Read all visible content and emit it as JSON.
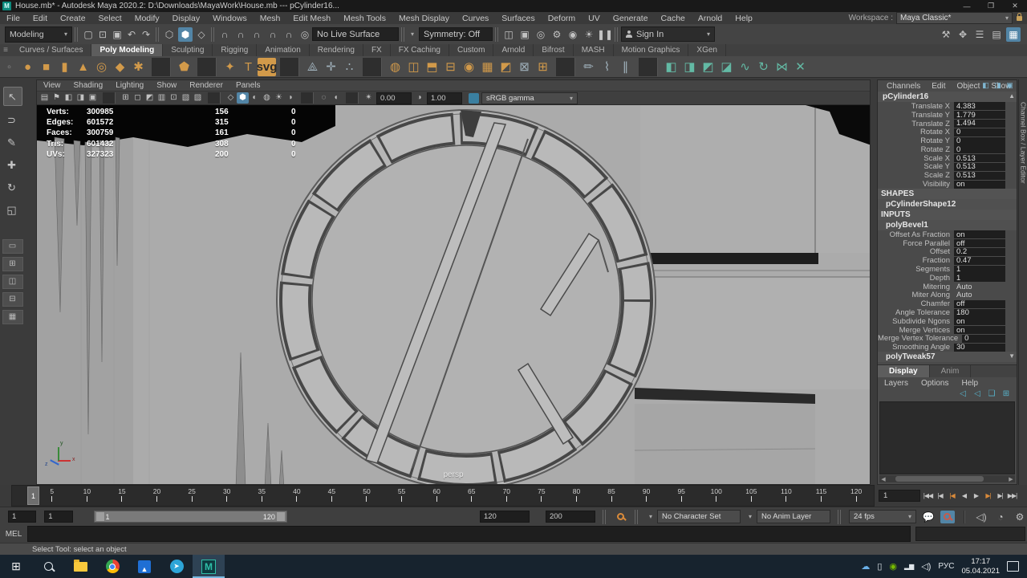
{
  "app": {
    "title": "House.mb* - Autodesk Maya 2020.2: D:\\Downloads\\MayaWork\\House.mb   ---   pCylinder16...",
    "icon": "M"
  },
  "window_controls": [
    {
      "name": "minimize-button",
      "glyph": "—"
    },
    {
      "name": "maximize-button",
      "glyph": "❐"
    },
    {
      "name": "close-button",
      "glyph": "✕"
    }
  ],
  "menu_bar": {
    "items": [
      "File",
      "Edit",
      "Create",
      "Select",
      "Modify",
      "Display",
      "Windows",
      "Mesh",
      "Edit Mesh",
      "Mesh Tools",
      "Mesh Display",
      "Curves",
      "Surfaces",
      "Deform",
      "UV",
      "Generate",
      "Cache",
      "Arnold",
      "Help"
    ]
  },
  "workspace": {
    "label": "Workspace :",
    "value": "Maya Classic*"
  },
  "status_line": {
    "mode": "Modeling",
    "file_icons": [
      {
        "name": "new-scene-icon",
        "glyph": "▢"
      },
      {
        "name": "open-scene-icon",
        "glyph": "⊡"
      },
      {
        "name": "save-scene-icon",
        "glyph": "▣"
      },
      {
        "name": "undo-icon",
        "glyph": "↶"
      },
      {
        "name": "redo-icon",
        "glyph": "↷"
      }
    ],
    "selection_icons": [
      {
        "name": "select-hierarchy-icon",
        "glyph": "⬡"
      },
      {
        "name": "select-object-icon",
        "glyph": "⬢",
        "cls": "active"
      },
      {
        "name": "select-component-icon",
        "glyph": "◇"
      }
    ],
    "snap_icons": [
      {
        "name": "snap-grid-icon",
        "glyph": "∩"
      },
      {
        "name": "snap-curve-icon",
        "glyph": "∩"
      },
      {
        "name": "snap-point-icon",
        "glyph": "∩"
      },
      {
        "name": "snap-projected-center-icon",
        "glyph": "∩"
      },
      {
        "name": "snap-view-plane-icon",
        "glyph": "∩"
      },
      {
        "name": "make-live-icon",
        "glyph": "◎"
      }
    ],
    "live_surface": "No Live Surface",
    "symmetry": "Symmetry: Off",
    "render_icons": [
      {
        "name": "render-view-icon",
        "glyph": "◫"
      },
      {
        "name": "render-current-frame-icon",
        "glyph": "▣"
      },
      {
        "name": "ipr-render-icon",
        "glyph": "◎"
      },
      {
        "name": "render-settings-icon",
        "glyph": "⚙"
      },
      {
        "name": "hypershade-icon",
        "glyph": "◉"
      },
      {
        "name": "light-editor-icon",
        "glyph": "☀"
      },
      {
        "name": "pause-viewport-icon",
        "glyph": "❚❚"
      }
    ],
    "sign_in": "Sign In",
    "right_icons": [
      {
        "name": "modeling-toolkit-toggle-icon",
        "glyph": "⚒"
      },
      {
        "name": "character-controls-toggle-icon",
        "glyph": "✥"
      },
      {
        "name": "attribute-editor-toggle-icon",
        "glyph": "☰"
      },
      {
        "name": "tool-settings-toggle-icon",
        "glyph": "▤"
      },
      {
        "name": "channel-box-toggle-icon",
        "glyph": "▦",
        "cls": "active"
      }
    ]
  },
  "shelf": {
    "tabs": [
      {
        "label": "Curves / Surfaces"
      },
      {
        "label": "Poly Modeling",
        "cls": "active"
      },
      {
        "label": "Sculpting"
      },
      {
        "label": "Rigging"
      },
      {
        "label": "Animation"
      },
      {
        "label": "Rendering"
      },
      {
        "label": "FX"
      },
      {
        "label": "FX Caching"
      },
      {
        "label": "Custom"
      },
      {
        "label": "Arnold"
      },
      {
        "label": "Bifrost"
      },
      {
        "label": "MASH"
      },
      {
        "label": "Motion Graphics"
      },
      {
        "label": "XGen"
      }
    ],
    "icons": [
      {
        "name": "poly-sphere-icon",
        "glyph": "●",
        "cls": "orange"
      },
      {
        "name": "poly-cube-icon",
        "glyph": "■",
        "cls": "orange"
      },
      {
        "name": "poly-cylinder-icon",
        "glyph": "▮",
        "cls": "orange"
      },
      {
        "name": "poly-cone-icon",
        "glyph": "▲",
        "cls": "orange"
      },
      {
        "name": "poly-torus-icon",
        "glyph": "◎",
        "cls": "orange"
      },
      {
        "name": "poly-plane-icon",
        "glyph": "◆",
        "cls": "orange"
      },
      {
        "name": "poly-disc-icon",
        "glyph": "✱",
        "cls": "orange"
      },
      {
        "cls": "vsep"
      },
      {
        "name": "platonic-solid-icon",
        "glyph": "⬟",
        "cls": "orange"
      },
      {
        "cls": "vsep"
      },
      {
        "name": "super-shape-icon",
        "glyph": "✦",
        "cls": "orange"
      },
      {
        "name": "poly-type-icon",
        "glyph": "T",
        "cls": "orange"
      },
      {
        "name": "svg-icon",
        "glyph": "svg",
        "cls": "badge"
      },
      {
        "cls": "vsep"
      },
      {
        "name": "construction-plane-icon",
        "glyph": "⟁",
        "cls": "gray"
      },
      {
        "name": "locator-icon",
        "glyph": "✛",
        "cls": "gray"
      },
      {
        "name": "origin-locator-icon",
        "glyph": "∴",
        "cls": "gray"
      },
      {
        "cls": "vsep"
      },
      {
        "name": "boolean-union-icon",
        "glyph": "◍",
        "cls": "orange"
      },
      {
        "name": "mirror-icon",
        "glyph": "◫",
        "cls": "orange"
      },
      {
        "name": "combine-icon",
        "glyph": "⬒",
        "cls": "orange"
      },
      {
        "name": "separate-icon",
        "glyph": "⊟",
        "cls": "orange"
      },
      {
        "name": "smooth-icon",
        "glyph": "◉",
        "cls": "orange"
      },
      {
        "name": "reduce-icon",
        "glyph": "▦",
        "cls": "orange"
      },
      {
        "name": "triangulate-icon",
        "glyph": "◩",
        "cls": "orange"
      },
      {
        "name": "fill-hole-icon",
        "glyph": "⊠",
        "cls": "gray"
      },
      {
        "name": "extrude-icon",
        "glyph": "⊞",
        "cls": "orange"
      },
      {
        "cls": "vsep"
      },
      {
        "name": "quad-draw-icon",
        "glyph": "✏",
        "cls": "gray"
      },
      {
        "name": "edit-edge-flow-icon",
        "glyph": "⌇",
        "cls": "gray"
      },
      {
        "name": "offset-edge-loop-icon",
        "glyph": "∥",
        "cls": "gray"
      },
      {
        "cls": "vsep"
      },
      {
        "name": "multi-cut-icon",
        "glyph": "◧",
        "cls": "green"
      },
      {
        "name": "connect-icon",
        "glyph": "◨",
        "cls": "green"
      },
      {
        "name": "crease-icon",
        "glyph": "◩",
        "cls": "green"
      },
      {
        "name": "bevel-icon",
        "glyph": "◪",
        "cls": "green"
      },
      {
        "name": "bridge-icon",
        "glyph": "∿",
        "cls": "green"
      },
      {
        "name": "spin-edge-icon",
        "glyph": "↻",
        "cls": "green"
      },
      {
        "name": "symmetrize-icon",
        "glyph": "⋈",
        "cls": "green"
      },
      {
        "name": "mirror-cut-icon",
        "glyph": "✕",
        "cls": "green"
      }
    ]
  },
  "toolbox": {
    "tools": [
      {
        "name": "select-tool-icon",
        "glyph": "↖",
        "cls": "boxed"
      },
      {
        "name": "lasso-tool-icon",
        "glyph": "⊃"
      },
      {
        "name": "paint-select-tool-icon",
        "glyph": "✎"
      },
      {
        "name": "move-tool-icon",
        "glyph": "✚"
      },
      {
        "name": "rotate-tool-icon",
        "glyph": "↻"
      },
      {
        "name": "scale-tool-icon",
        "glyph": "◱"
      }
    ],
    "layouts": [
      {
        "name": "layout-single-pane-icon",
        "glyph": "▭"
      },
      {
        "name": "layout-four-pane-icon",
        "glyph": "⊞"
      },
      {
        "name": "layout-two-pane-icon",
        "glyph": "◫"
      },
      {
        "name": "layout-outliner-icon",
        "glyph": "⊟"
      },
      {
        "name": "layout-grid-icon",
        "glyph": "▦"
      }
    ]
  },
  "viewport": {
    "menus": [
      "View",
      "Shading",
      "Lighting",
      "Show",
      "Renderer",
      "Panels"
    ],
    "toolbar_icons": [
      {
        "name": "camera-attributes-icon",
        "glyph": "▤"
      },
      {
        "name": "bookmark-icon",
        "glyph": "⚑"
      },
      {
        "name": "previous-view-icon",
        "glyph": "◧"
      },
      {
        "name": "next-view-icon",
        "glyph": "◨"
      },
      {
        "name": "image-plane-icon",
        "glyph": "▣"
      },
      {
        "cls": "vsep"
      },
      {
        "name": "grid-toggle-icon",
        "glyph": "⊞"
      },
      {
        "name": "film-gate-icon",
        "glyph": "◻"
      },
      {
        "name": "resolution-gate-icon",
        "glyph": "◩"
      },
      {
        "name": "gate-mask-icon",
        "glyph": "▥"
      },
      {
        "name": "field-chart-icon",
        "glyph": "⊡"
      },
      {
        "name": "safe-action-icon",
        "glyph": "▧"
      },
      {
        "name": "safe-title-icon",
        "glyph": "▨"
      },
      {
        "cls": "vsep"
      },
      {
        "name": "wireframe-icon",
        "glyph": "◇"
      },
      {
        "name": "shaded-icon",
        "glyph": "⬢",
        "cls": "active"
      },
      {
        "name": "textured-icon",
        "glyph": "◐"
      },
      {
        "name": "use-default-material-icon",
        "glyph": "◍"
      },
      {
        "name": "lighting-icon",
        "glyph": "☀"
      },
      {
        "name": "shadows-icon",
        "glyph": "◗"
      },
      {
        "cls": "vsep"
      },
      {
        "name": "isolate-select-icon",
        "glyph": "◌"
      },
      {
        "name": "xray-icon",
        "glyph": "◖"
      },
      {
        "cls": "vsep"
      },
      {
        "name": "exposure-icon",
        "glyph": "✴"
      }
    ],
    "exposure": "0.00",
    "gamma_icon": "◑",
    "gamma": "1.00",
    "colorspace": "sRGB gamma",
    "camera_label": "persp",
    "hud": {
      "rows": [
        {
          "label": "Verts:",
          "a": "300985",
          "b": "156",
          "c": "0"
        },
        {
          "label": "Edges:",
          "a": "601572",
          "b": "315",
          "c": "0"
        },
        {
          "label": "Faces:",
          "a": "300759",
          "b": "161",
          "c": "0"
        },
        {
          "label": "Tris:",
          "a": "601432",
          "b": "308",
          "c": "0"
        },
        {
          "label": "UVs:",
          "a": "327323",
          "b": "200",
          "c": "0"
        }
      ]
    },
    "axis_labels": {
      "x": "x",
      "y": "y",
      "z": "z"
    }
  },
  "channel_box": {
    "menus": [
      "Channels",
      "Edit",
      "Object",
      "Show"
    ],
    "top_icons": [
      {
        "name": "manipulator-icon",
        "glyph": "◧"
      },
      {
        "name": "speed-state-icon",
        "glyph": "◨"
      },
      {
        "name": "pin-channel-icon",
        "glyph": "▣"
      }
    ],
    "node": "pCylinder16",
    "channels": [
      {
        "label": "Translate X",
        "value": "4.383"
      },
      {
        "label": "Translate Y",
        "value": "1.779"
      },
      {
        "label": "Translate Z",
        "value": "1.494"
      },
      {
        "label": "Rotate X",
        "value": "0"
      },
      {
        "label": "Rotate Y",
        "value": "0"
      },
      {
        "label": "Rotate Z",
        "value": "0"
      },
      {
        "label": "Scale X",
        "value": "0.513"
      },
      {
        "label": "Scale Y",
        "value": "0.513"
      },
      {
        "label": "Scale Z",
        "value": "0.513"
      },
      {
        "label": "Visibility",
        "value": "on"
      }
    ],
    "shapes_header": "SHAPES",
    "shape_node": "pCylinderShape12",
    "inputs_header": "INPUTS",
    "input_node": "polyBevel1",
    "input_channels": [
      {
        "label": "Offset As Fraction",
        "value": "on"
      },
      {
        "label": "Force Parallel",
        "value": "off"
      },
      {
        "label": "Offset",
        "value": "0.2"
      },
      {
        "label": "Fraction",
        "value": "0.47"
      },
      {
        "label": "Segments",
        "value": "1"
      },
      {
        "label": "Depth",
        "value": "1"
      },
      {
        "label": "Mitering",
        "value": "Auto",
        "cls": "plain"
      },
      {
        "label": "Miter Along",
        "value": "Auto",
        "cls": "plain"
      },
      {
        "label": "Chamfer",
        "value": "off"
      },
      {
        "label": "Angle Tolerance",
        "value": "180"
      },
      {
        "label": "Subdivide Ngons",
        "value": "on"
      },
      {
        "label": "Merge Vertices",
        "value": "on"
      },
      {
        "label": "Merge Vertex Tolerance",
        "value": "0"
      },
      {
        "label": "Smoothing Angle",
        "value": "30"
      }
    ],
    "next_node": "polyTweak57",
    "side_tab": "Channel Box / Layer Editor"
  },
  "layer_editor": {
    "tabs": [
      {
        "label": "Display",
        "cls": "active"
      },
      {
        "label": "Anim"
      }
    ],
    "menus": [
      "Layers",
      "Options",
      "Help"
    ],
    "icons": [
      {
        "name": "layer-move-up-icon",
        "glyph": "◁"
      },
      {
        "name": "layer-move-down-icon",
        "glyph": "◁"
      },
      {
        "name": "new-empty-layer-icon",
        "glyph": "❑"
      },
      {
        "name": "new-layer-from-selected-icon",
        "glyph": "⊞"
      }
    ]
  },
  "time_slider": {
    "playhead": "1",
    "ticks": [
      5,
      10,
      15,
      20,
      25,
      30,
      35,
      40,
      45,
      50,
      55,
      60,
      65,
      70,
      75,
      80,
      85,
      90,
      95,
      100,
      105,
      110,
      115,
      120
    ],
    "current_time": "1",
    "playback": [
      {
        "name": "go-to-start-button",
        "glyph": "|◀◀"
      },
      {
        "name": "step-back-frame-button",
        "glyph": "|◀"
      },
      {
        "name": "step-back-key-button",
        "glyph": "|◀",
        "cls": "accent"
      },
      {
        "name": "play-backwards-button",
        "glyph": "◀"
      },
      {
        "name": "play-forwards-button",
        "glyph": "▶"
      },
      {
        "name": "step-forward-key-button",
        "glyph": "▶|",
        "cls": "accent"
      },
      {
        "name": "step-forward-frame-button",
        "glyph": "▶|"
      },
      {
        "name": "go-to-end-button",
        "glyph": "▶▶|"
      }
    ]
  },
  "range_slider": {
    "anim_start": "1",
    "play_start": "1",
    "bar_start": "1",
    "bar_end": "120",
    "play_end": "120",
    "anim_end": "200",
    "character_set": "No Character Set",
    "anim_layer": "No Anim Layer",
    "fps": "24 fps"
  },
  "command_line": {
    "label": "MEL"
  },
  "help_line": {
    "text": "Select Tool: select an object"
  },
  "taskbar": {
    "language": "РУС",
    "time": "17:17",
    "date": "05.04.2021"
  },
  "colors": {
    "accent_blue": "#5285a6",
    "shelf_orange": "#d29a4a",
    "shelf_green": "#63b9a4",
    "key_orange": "#d98a3a",
    "taskbar_bg": "#17232e",
    "viewport_gray": "#ababab"
  }
}
